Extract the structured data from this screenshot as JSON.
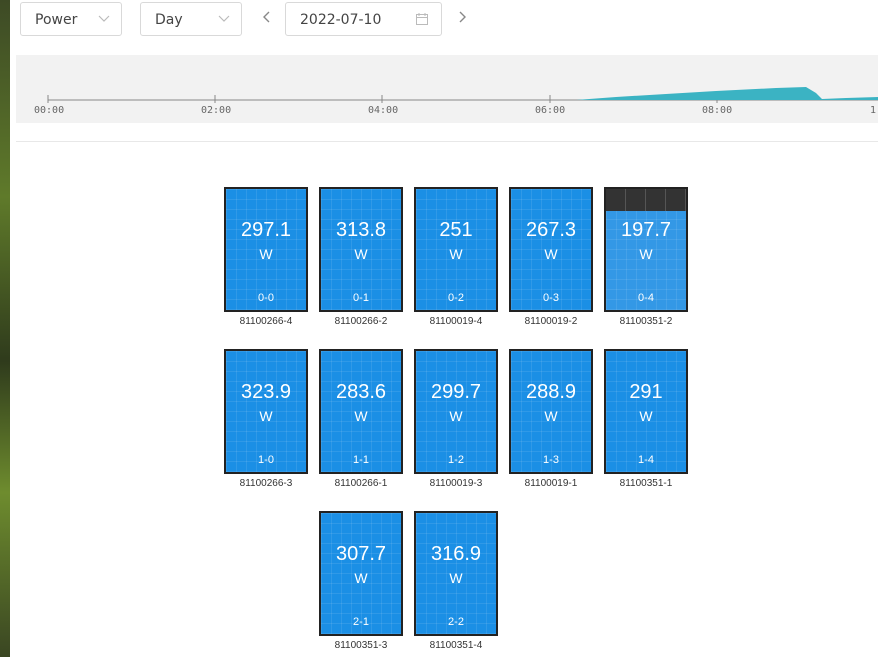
{
  "toolbar": {
    "metric_select": "Power",
    "period_select": "Day",
    "prev_label": "<",
    "next_label": ">",
    "date": "2022-07-10"
  },
  "timeline": {
    "ticks": [
      "00:00",
      "02:00",
      "04:00",
      "06:00",
      "08:00",
      "1"
    ]
  },
  "panels": [
    {
      "value": "297.1",
      "unit": "W",
      "pos": "0-0",
      "sn": "81100266-4",
      "shaded": false
    },
    {
      "value": "313.8",
      "unit": "W",
      "pos": "0-1",
      "sn": "81100266-2",
      "shaded": false
    },
    {
      "value": "251",
      "unit": "W",
      "pos": "0-2",
      "sn": "81100019-4",
      "shaded": false
    },
    {
      "value": "267.3",
      "unit": "W",
      "pos": "0-3",
      "sn": "81100019-2",
      "shaded": false
    },
    {
      "value": "197.7",
      "unit": "W",
      "pos": "0-4",
      "sn": "81100351-2",
      "shaded": true
    },
    {
      "value": "323.9",
      "unit": "W",
      "pos": "1-0",
      "sn": "81100266-3",
      "shaded": false
    },
    {
      "value": "283.6",
      "unit": "W",
      "pos": "1-1",
      "sn": "81100266-1",
      "shaded": false
    },
    {
      "value": "299.7",
      "unit": "W",
      "pos": "1-2",
      "sn": "81100019-3",
      "shaded": false
    },
    {
      "value": "288.9",
      "unit": "W",
      "pos": "1-3",
      "sn": "81100019-1",
      "shaded": false
    },
    {
      "value": "291",
      "unit": "W",
      "pos": "1-4",
      "sn": "81100351-1",
      "shaded": false
    },
    {
      "value": "307.7",
      "unit": "W",
      "pos": "2-1",
      "sn": "81100351-3",
      "shaded": false
    },
    {
      "value": "316.9",
      "unit": "W",
      "pos": "2-2",
      "sn": "81100351-4",
      "shaded": false
    }
  ],
  "colors": {
    "panel_blue": "#1b8fe5",
    "area_teal": "#3bb3c3"
  }
}
